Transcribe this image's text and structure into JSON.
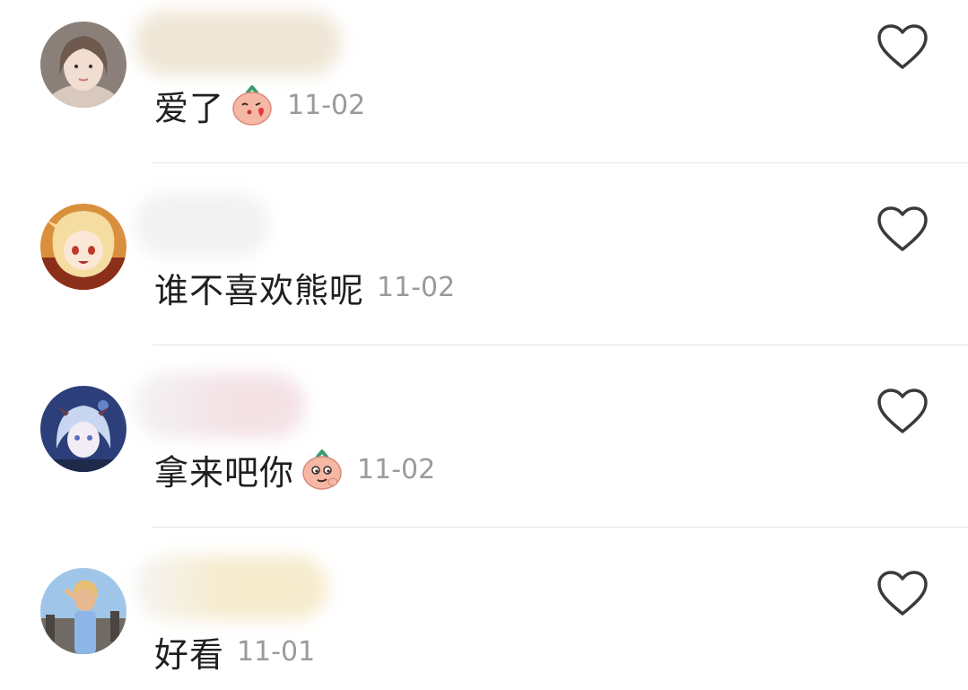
{
  "comments": [
    {
      "text": "爱了",
      "emoji_icon": "kissing-heart-peach-emoji",
      "date": "11-02",
      "name_smudge_color": "#efe6d6"
    },
    {
      "text": "谁不喜欢熊呢",
      "emoji_icon": "",
      "date": "11-02",
      "name_smudge_color": "#f2f2f2"
    },
    {
      "text": "拿来吧你",
      "emoji_icon": "smirking-peach-emoji",
      "date": "11-02",
      "name_smudge_color": "#f4e2e6"
    },
    {
      "text": "好看",
      "emoji_icon": "",
      "date": "11-01",
      "name_smudge_color": "#f6ebcd"
    }
  ],
  "icons": {
    "like": "heart-outline-icon"
  },
  "colors": {
    "text": "#1f1f1f",
    "date": "#9a9a9a",
    "divider": "#e6e6e6",
    "heart_stroke": "#3a3a3a"
  }
}
